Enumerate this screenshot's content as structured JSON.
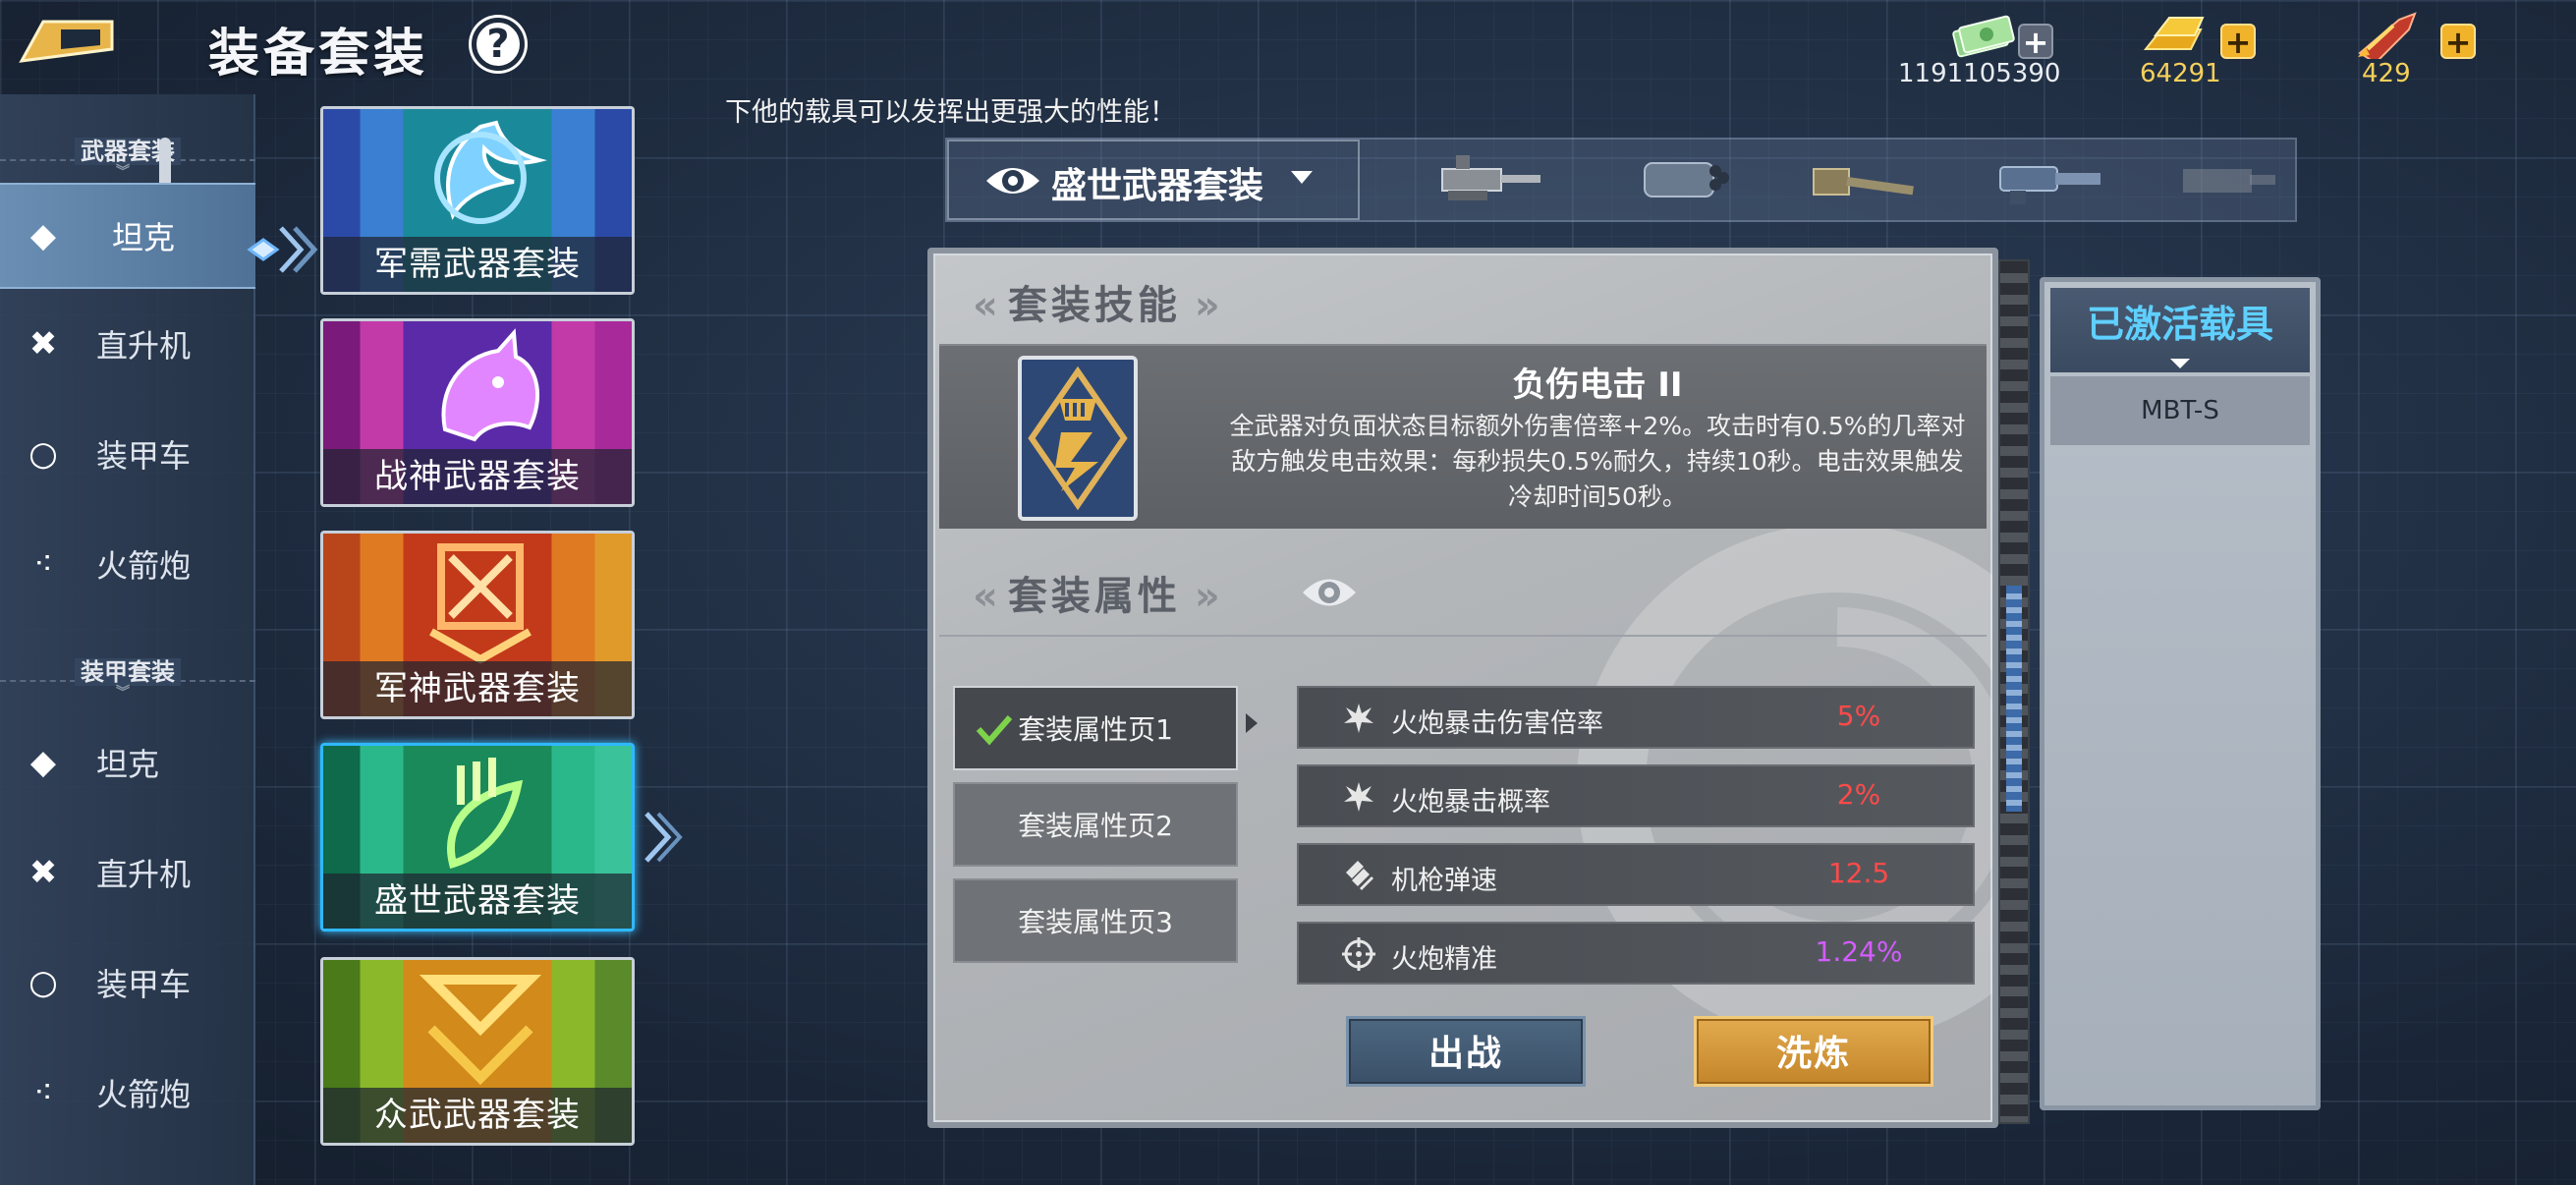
{
  "header": {
    "title": "装备套装",
    "help_label": "?",
    "currencies": {
      "cash": {
        "amount": "1191105390",
        "plus": "+",
        "icon": "cash-icon"
      },
      "gold": {
        "amount": "64291",
        "plus": "+",
        "icon": "gold-bar-icon"
      },
      "rocket": {
        "amount": "429",
        "plus": "+",
        "icon": "rocket-icon"
      }
    }
  },
  "marquee": "下他的载具可以发挥出更强大的性能！",
  "sidebar": {
    "weapon_section": "武器套装",
    "armor_section": "装甲套装",
    "weapon_items": [
      {
        "label": "坦克",
        "icon": "diamond-icon",
        "glyph": "◆"
      },
      {
        "label": "直升机",
        "icon": "cross-icon",
        "glyph": "✖"
      },
      {
        "label": "装甲车",
        "icon": "circle-icon",
        "glyph": "○"
      },
      {
        "label": "火箭炮",
        "icon": "triangle-dots-icon",
        "glyph": "⁖"
      }
    ],
    "armor_items": [
      {
        "label": "坦克",
        "icon": "diamond-icon",
        "glyph": "◆"
      },
      {
        "label": "直升机",
        "icon": "cross-icon",
        "glyph": "✖"
      },
      {
        "label": "装甲车",
        "icon": "circle-icon",
        "glyph": "○"
      },
      {
        "label": "火箭炮",
        "icon": "triangle-dots-icon",
        "glyph": "⁖"
      }
    ]
  },
  "sets": [
    {
      "name": "军需武器套装",
      "colors": [
        "#2b4aa8",
        "#3a7fd1",
        "#1a8a9a",
        "#2b4aa8"
      ],
      "icon": "wings-emblem-icon"
    },
    {
      "name": "战神武器套装",
      "colors": [
        "#7a1a7a",
        "#c23aa8",
        "#5b2aa8",
        "#a82a9a"
      ],
      "icon": "lion-emblem-icon"
    },
    {
      "name": "军神武器套装",
      "colors": [
        "#b8461a",
        "#e07a22",
        "#c23a1a",
        "#e09a2a"
      ],
      "icon": "shield-emblem-icon"
    },
    {
      "name": "盛世武器套装",
      "colors": [
        "#0e6a4a",
        "#2ab88a",
        "#1a8a5a",
        "#3ac29a"
      ],
      "icon": "leaf-emblem-icon"
    },
    {
      "name": "众武武器套装",
      "colors": [
        "#4a7a1a",
        "#8ab82a",
        "#d28a1a",
        "#5a8a2a"
      ],
      "icon": "chevron-emblem-icon"
    }
  ],
  "weapons_bar": {
    "selected_set": "盛世武器套装",
    "slots": [
      "machine-gun-icon",
      "heavy-gun-icon",
      "gatling-icon",
      "cannon-icon",
      "minigun-icon",
      "empty-slot-icon"
    ]
  },
  "skill": {
    "section_title": "套装技能",
    "name": "负伤电击 II",
    "description": "全武器对负面状态目标额外伤害倍率+2%。攻击时有0.5%的几率对敌方触发电击效果：每秒损失0.5%耐久，持续10秒。电击效果触发冷却时间50秒。"
  },
  "attributes": {
    "section_title": "套装属性",
    "pages": [
      "套装属性页1",
      "套装属性页2",
      "套装属性页3"
    ],
    "stats": [
      {
        "name": "火炮暴击伤害倍率",
        "value": "5%",
        "color": "#ff4a4a",
        "icon": "splat-icon"
      },
      {
        "name": "火炮暴击概率",
        "value": "2%",
        "color": "#ff4a4a",
        "icon": "splat-icon"
      },
      {
        "name": "机枪弹速",
        "value": "12.5",
        "color": "#ff4a4a",
        "icon": "bullets-icon"
      },
      {
        "name": "火炮精准",
        "value": "1.24%",
        "color": "#d35cff",
        "icon": "crosshair-icon"
      }
    ]
  },
  "actions": {
    "deploy": "出战",
    "refine": "洗炼"
  },
  "activated": {
    "title": "已激活载具",
    "vehicles": [
      "MBT-S"
    ]
  }
}
